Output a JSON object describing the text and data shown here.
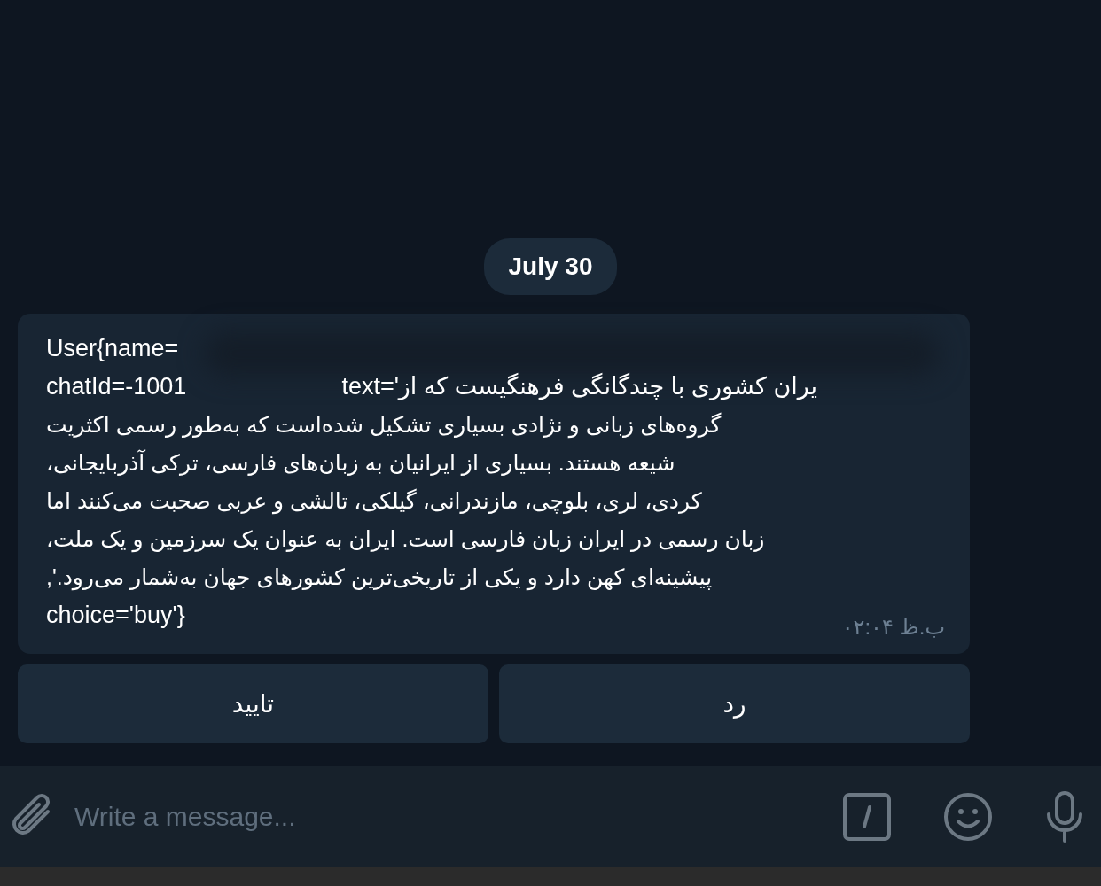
{
  "date": "July 30",
  "message": {
    "lines": [
      {
        "text": "User{name=",
        "rtl": false
      },
      {
        "lead": "chatId=-1001",
        "text": "text='یران کشوری با چندگانگی فرهنگیست که از",
        "rtl": false
      },
      {
        "text": "گروه‌های زبانی و نژادی بسیاری تشکیل شده‌است که به‌طور رسمی اکثریت",
        "rtl": true
      },
      {
        "text": "شیعه هستند. بسیاری از ایرانیان به زبان‌های فارسی، ترکی آذربایجانی،",
        "rtl": true
      },
      {
        "text": "کردی، لری، بلوچی، مازندرانی، گیلکی، تالشی و عربی صحبت می‌کنند اما",
        "rtl": true
      },
      {
        "text": "زبان رسمی در ایران زبان فارسی است. ایران به عنوان یک سرزمین و یک ملت،",
        "rtl": true
      },
      {
        "text": "پیشینه‌ای کهن دارد و یکی از تاریخی‌ترین کشورهای جهان به‌شمار می‌رود.',",
        "rtl": true
      },
      {
        "text": "choice='buy'}",
        "rtl": false
      }
    ],
    "time": "ب.ظ ۰۲:۰۴"
  },
  "buttons": [
    {
      "label": "رد"
    },
    {
      "label": "تایید"
    }
  ],
  "composer": {
    "placeholder": "Write a message..."
  }
}
